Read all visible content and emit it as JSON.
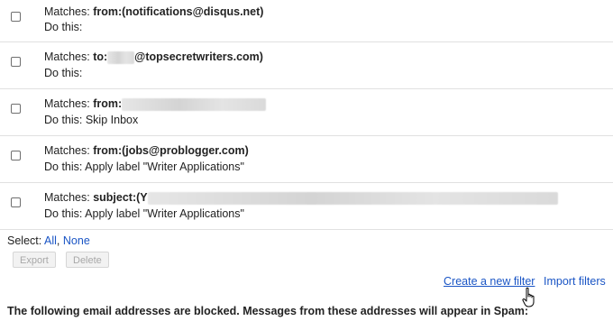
{
  "filters": [
    {
      "prefix": "Matches: ",
      "criteria": "from:(notifications@disqus.net)",
      "action": "Do this:"
    },
    {
      "prefix": "Matches: ",
      "criteria": "to:",
      "criteria_suffix": "@topsecretwriters.com)",
      "action": "Do this:"
    },
    {
      "prefix": "Matches: ",
      "criteria": "from:",
      "action": "Do this: Skip Inbox"
    },
    {
      "prefix": "Matches: ",
      "criteria": "from:(jobs@problogger.com)",
      "action": "Do this: Apply label \"Writer Applications\""
    },
    {
      "prefix": "Matches: ",
      "criteria": "subject:(Y",
      "action": "Do this: Apply label \"Writer Applications\""
    }
  ],
  "selection": {
    "label": "Select:",
    "all": "All",
    "separator": ",",
    "none": "None"
  },
  "buttons": {
    "export": "Export",
    "delete": "Delete"
  },
  "links": {
    "create_filter": "Create a new filter",
    "import_filters": "Import filters"
  },
  "blocked_notice": "The following email addresses are blocked. Messages from these addresses will appear in Spam:",
  "colors": {
    "link": "#1a55c5",
    "divider": "#e1e1e1",
    "disabled_text": "#a8a8a8"
  },
  "icons": {
    "cursor": "hand-pointer-icon"
  }
}
